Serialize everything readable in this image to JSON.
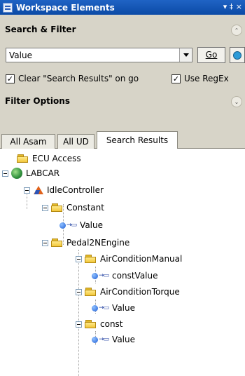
{
  "window": {
    "title": "Workspace Elements",
    "pin_glyph": "▾  ‡  ×"
  },
  "search_filter": {
    "title": "Search & Filter",
    "query_value": "Value",
    "go_label": "Go",
    "clear_results_label": "Clear \"Search Results\" on go",
    "clear_results_checked": "✓",
    "use_regex_label": "Use RegEx",
    "use_regex_checked": "✓"
  },
  "filter_options": {
    "title": "Filter Options"
  },
  "tabs": [
    "All Asam",
    "All UD",
    "Search Results"
  ],
  "tree": [
    {
      "label": "ECU Access",
      "icon": "folder-icon"
    },
    {
      "label": "LABCAR",
      "icon": "globe-icon"
    },
    {
      "label": "IdleController",
      "icon": "matlab-icon"
    },
    {
      "label": "Constant",
      "icon": "folder-icon"
    },
    {
      "label": "Value",
      "icon": "variable-icon"
    },
    {
      "label": "Pedal2NEngine",
      "icon": "folder-icon"
    },
    {
      "label": "AirConditionManual",
      "icon": "folder-icon"
    },
    {
      "label": "constValue",
      "icon": "variable-icon"
    },
    {
      "label": "AirConditionTorque",
      "icon": "folder-icon"
    },
    {
      "label": "Value",
      "icon": "variable-icon"
    },
    {
      "label": "const",
      "icon": "folder-icon"
    },
    {
      "label": "Value",
      "icon": "variable-icon"
    }
  ]
}
